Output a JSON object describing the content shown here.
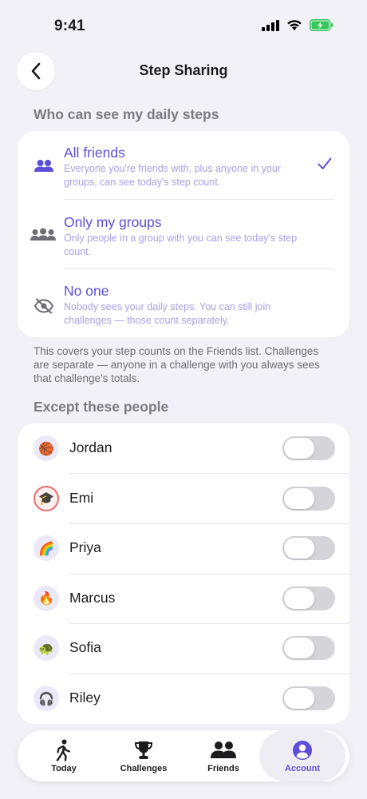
{
  "status_bar": {
    "time": "9:41"
  },
  "nav": {
    "title": "Step Sharing"
  },
  "visibility": {
    "header": "Who can see my daily steps",
    "options": [
      {
        "title": "All friends",
        "subtitle": "Everyone you're friends with, plus anyone in your groups, can see today's step count.",
        "icon": "friends-icon",
        "selected": true
      },
      {
        "title": "Only my groups",
        "subtitle": "Only people in a group with you can see today's step count.",
        "icon": "groups-icon",
        "selected": false
      },
      {
        "title": "No one",
        "subtitle": "Nobody sees your daily steps. You can still join challenges — those count separately.",
        "icon": "eye-slash-icon",
        "selected": false
      }
    ],
    "footnote": "This covers your step counts on the Friends list. Challenges are separate — anyone in a challenge with you always sees that challenge's totals."
  },
  "exceptions": {
    "header": "Except these people",
    "people": [
      {
        "name": "Jordan",
        "emoji": "🏀",
        "enabled": false
      },
      {
        "name": "Emi",
        "emoji": "🎓",
        "enabled": false
      },
      {
        "name": "Priya",
        "emoji": "🌈",
        "enabled": false
      },
      {
        "name": "Marcus",
        "emoji": "🔥",
        "enabled": false
      },
      {
        "name": "Sofia",
        "emoji": "🐢",
        "enabled": false
      },
      {
        "name": "Riley",
        "emoji": "🎧",
        "enabled": false
      }
    ]
  },
  "tab_bar": {
    "tabs": [
      {
        "label": "Today",
        "icon": "walking-icon"
      },
      {
        "label": "Challenges",
        "icon": "trophy-icon"
      },
      {
        "label": "Friends",
        "icon": "friends-icon"
      },
      {
        "label": "Account",
        "icon": "account-icon",
        "active": true
      }
    ]
  },
  "colors": {
    "accent": "#5b4fd9",
    "background": "#f2f1f7"
  }
}
